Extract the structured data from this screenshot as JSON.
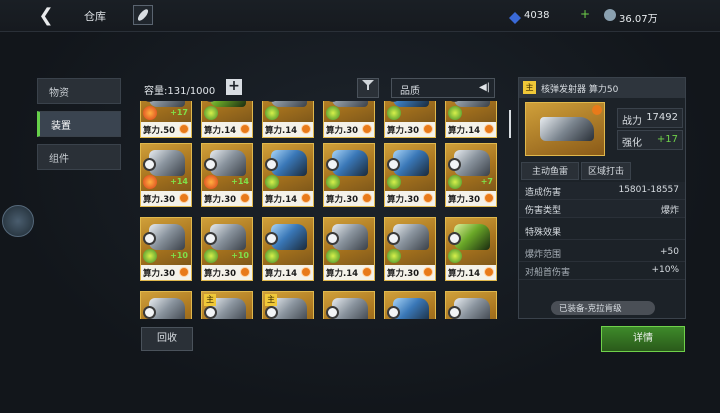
{
  "header": {
    "title": "仓库",
    "resource1": "4038",
    "resource2": "36.07万",
    "plus": "+"
  },
  "tabs": [
    {
      "label": "物资",
      "active": false
    },
    {
      "label": "装置",
      "active": true
    },
    {
      "label": "组件",
      "active": false
    }
  ],
  "toolbar": {
    "capacity": "容量:131/1000",
    "add": "+",
    "quality": "品质"
  },
  "cards": [
    {
      "power": "算力.50",
      "enh": "+17",
      "tone": "gray",
      "ring": "red"
    },
    {
      "power": "算力.14",
      "enh": "",
      "tone": "green",
      "ring": "green"
    },
    {
      "power": "算力.14",
      "enh": "",
      "tone": "gray",
      "ring": "green"
    },
    {
      "power": "算力.30",
      "enh": "",
      "tone": "gray",
      "ring": "green"
    },
    {
      "power": "算力.30",
      "enh": "",
      "tone": "blue",
      "ring": "green"
    },
    {
      "power": "算力.14",
      "enh": "",
      "tone": "gray",
      "ring": "green"
    },
    {
      "power": "算力.30",
      "enh": "+14",
      "tone": "gray",
      "ring": "red"
    },
    {
      "power": "算力.30",
      "enh": "+14",
      "tone": "gray",
      "ring": "red"
    },
    {
      "power": "算力.14",
      "enh": "",
      "tone": "blue",
      "ring": "green"
    },
    {
      "power": "算力.30",
      "enh": "",
      "tone": "blue",
      "ring": "green"
    },
    {
      "power": "算力.30",
      "enh": "",
      "tone": "blue",
      "ring": "green"
    },
    {
      "power": "算力.30",
      "enh": "+7",
      "tone": "gray",
      "ring": "green"
    },
    {
      "power": "算力.30",
      "enh": "+10",
      "tone": "gray",
      "ring": "green"
    },
    {
      "power": "算力.30",
      "enh": "+10",
      "tone": "gray",
      "ring": "green"
    },
    {
      "power": "算力.14",
      "enh": "",
      "tone": "blue",
      "ring": "green"
    },
    {
      "power": "算力.14",
      "enh": "",
      "tone": "gray",
      "ring": "green"
    },
    {
      "power": "算力.30",
      "enh": "",
      "tone": "gray",
      "ring": "green"
    },
    {
      "power": "算力.14",
      "enh": "",
      "tone": "green",
      "ring": "green"
    },
    {
      "power": "",
      "enh": "",
      "tone": "gray",
      "ring": "green",
      "main": false
    },
    {
      "power": "",
      "enh": "",
      "tone": "gray",
      "ring": "green",
      "main": true
    },
    {
      "power": "",
      "enh": "",
      "tone": "gray",
      "ring": "green",
      "main": true
    },
    {
      "power": "",
      "enh": "",
      "tone": "gray",
      "ring": "green",
      "main": false
    },
    {
      "power": "",
      "enh": "",
      "tone": "blue",
      "ring": "green",
      "main": false
    },
    {
      "power": "",
      "enh": "",
      "tone": "gray",
      "ring": "green",
      "main": false
    }
  ],
  "recycle": "回收",
  "detail_panel": {
    "main_tag": "主",
    "name": "核弹发射器 算力50",
    "combat_label": "战力",
    "combat_value": "17492",
    "enhance_label": "强化",
    "enhance_value": "+17",
    "tab1": "主动鱼雷",
    "tab2": "区域打击",
    "damage_label": "造成伤害",
    "damage_value": "15801-18557",
    "type_label": "伤害类型",
    "type_value": "爆炸",
    "special_label": "特殊效果",
    "blast_label": "爆炸范围",
    "blast_value": "+50",
    "ship_label": "对船首伤害",
    "ship_value": "+10%",
    "equipped": "已装备-克拉肯级",
    "details_button": "详情"
  }
}
